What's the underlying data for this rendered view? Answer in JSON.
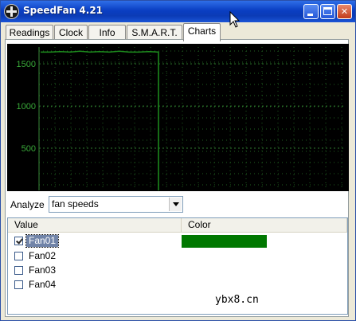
{
  "window": {
    "title": "SpeedFan 4.21"
  },
  "tabs": [
    {
      "label": "Readings",
      "active": false
    },
    {
      "label": "Clock",
      "active": false
    },
    {
      "label": "Info",
      "active": false
    },
    {
      "label": "S.M.A.R.T.",
      "active": false
    },
    {
      "label": "Charts",
      "active": true
    }
  ],
  "chart_data": {
    "type": "line",
    "yticks": [
      "1500",
      "1000",
      "500"
    ],
    "ylim": [
      0,
      1700
    ],
    "grid": true,
    "series": [
      {
        "color": "#1e8f1e",
        "description_values": [
          1640,
          1640,
          1645,
          1640,
          1650,
          1640,
          1645,
          1640,
          1650,
          1640,
          1640,
          1645,
          1640,
          0
        ]
      }
    ]
  },
  "analyze": {
    "label": "Analyze",
    "selected": "fan speeds"
  },
  "list": {
    "columns": [
      "Value",
      "Color"
    ],
    "rows": [
      {
        "label": "Fan01",
        "checked": true,
        "selected": true,
        "color": "#007800"
      },
      {
        "label": "Fan02",
        "checked": false,
        "selected": false
      },
      {
        "label": "Fan03",
        "checked": false,
        "selected": false
      },
      {
        "label": "Fan04",
        "checked": false,
        "selected": false
      }
    ]
  },
  "watermark": "ybx8.cn",
  "icons": {
    "app": "speedfan-fan-icon",
    "minimize": "minimize-icon",
    "maximize": "maximize-icon",
    "close": "close-icon",
    "cursor": "mouse-cursor-icon"
  }
}
